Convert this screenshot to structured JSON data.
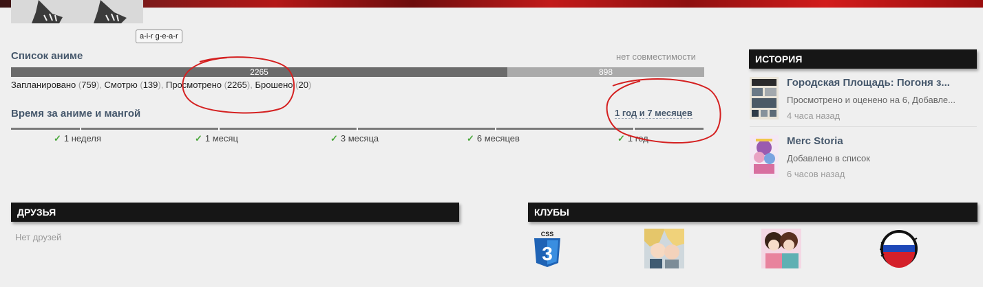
{
  "profile": {
    "nickname": "a-i-r g-e-a-r"
  },
  "anime_list": {
    "title": "Список аниме",
    "compat": "нет совместимости",
    "bar": {
      "completed_label": "2265",
      "completed": 2265,
      "dropped_label": "898",
      "dropped": 898
    },
    "statuses": [
      {
        "label": "Запланировано",
        "count": "759"
      },
      {
        "label": "Смотрю",
        "count": "139"
      },
      {
        "label": "Просмотрено",
        "count": "2265"
      },
      {
        "label": "Брошено",
        "count": "20"
      }
    ]
  },
  "time": {
    "title": "Время за аниме и мангой",
    "total": "1 год и 7 месяцев",
    "milestones": [
      "1 неделя",
      "1 месяц",
      "3 месяца",
      "6 месяцев",
      "1 год"
    ]
  },
  "history": {
    "title": "ИСТОРИЯ",
    "items": [
      {
        "title": "Городская Площадь: Погоня з...",
        "sub": "Просмотрено и оценено на 6, Добавле...",
        "time": "4 часа назад"
      },
      {
        "title": "Merc Storia",
        "sub": "Добавлено в список",
        "time": "6 часов назад"
      }
    ]
  },
  "friends": {
    "title": "ДРУЗЬЯ",
    "empty": "Нет друзей"
  },
  "clubs": {
    "title": "КЛУБЫ",
    "css_logo_text": "CSS",
    "css_logo_number": "3"
  },
  "colors": {
    "heading": "#46586c",
    "bar_completed": "#6b6b6b",
    "bar_dropped": "#aaaaaa",
    "check": "#4aa83c",
    "annotation": "#d42020",
    "header_block": "#161616"
  }
}
